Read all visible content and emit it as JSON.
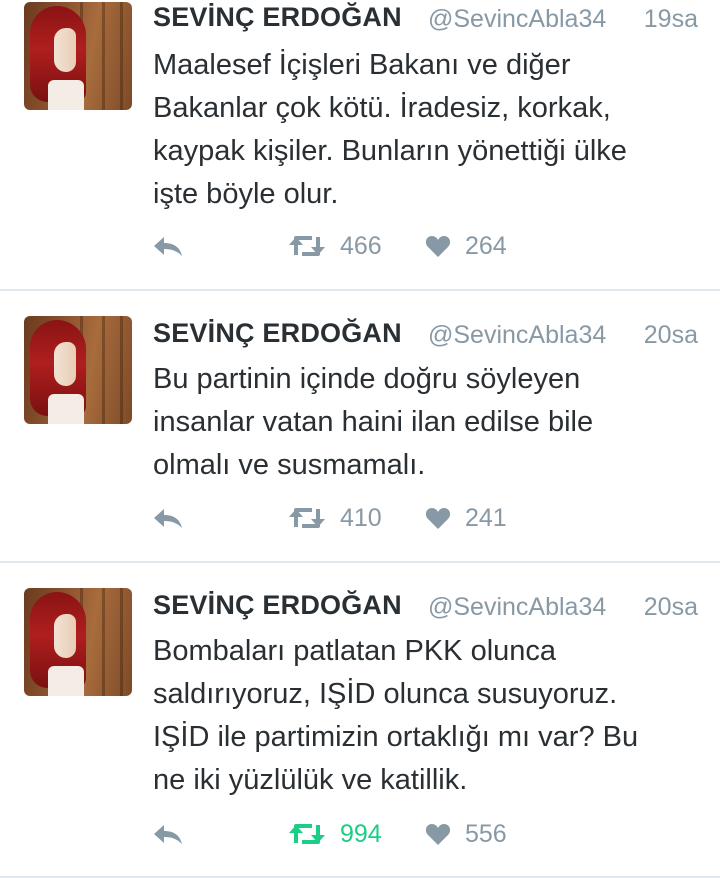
{
  "colors": {
    "name": "#292f33",
    "meta": "#8899a6",
    "retweet_active": "#19cf86",
    "divider": "#e1e8ed"
  },
  "tweets": [
    {
      "name": "SEVİNÇ ERDOĞAN",
      "handle": "@SevincAbla34",
      "time": "19sa",
      "text_lines": [
        "Maalesef İçişleri Bakanı ve diğer",
        "Bakanlar çok kötü. İradesiz, korkak,",
        "kaypak kişiler. Bunların yönettiği ülke",
        "işte böyle olur."
      ],
      "retweets": "466",
      "likes": "264",
      "retweeted": false,
      "icons": {
        "reply": "reply-icon",
        "retweet": "retweet-icon",
        "like": "heart-icon"
      }
    },
    {
      "name": "SEVİNÇ ERDOĞAN",
      "handle": "@SevincAbla34",
      "time": "20sa",
      "text_lines": [
        "Bu partinin içinde doğru söyleyen",
        "insanlar vatan haini ilan edilse bile",
        "olmalı ve susmamalı."
      ],
      "retweets": "410",
      "likes": "241",
      "retweeted": false,
      "icons": {
        "reply": "reply-icon",
        "retweet": "retweet-icon",
        "like": "heart-icon"
      }
    },
    {
      "name": "SEVİNÇ ERDOĞAN",
      "handle": "@SevincAbla34",
      "time": "20sa",
      "text_lines": [
        "Bombaları patlatan PKK olunca",
        "saldırıyoruz, IŞİD olunca susuyoruz.",
        "IŞİD ile partimizin ortaklığı mı var? Bu",
        "ne iki yüzlülük ve katillik."
      ],
      "retweets": "994",
      "likes": "556",
      "retweeted": true,
      "icons": {
        "reply": "reply-icon",
        "retweet": "retweet-icon",
        "like": "heart-icon"
      }
    }
  ]
}
